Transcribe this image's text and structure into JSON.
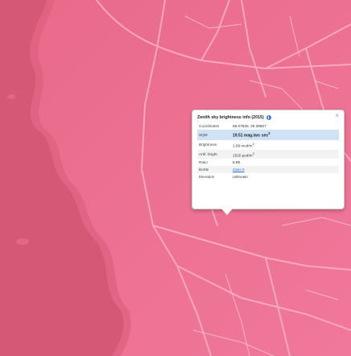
{
  "map": {
    "colors": {
      "water": "#d85a7a",
      "land": "#eb6f8f",
      "roads": "#f5a3ba"
    },
    "popup": {
      "title": "Zenith sky brightness info (2015)",
      "close_symbol": "×",
      "rows": [
        {
          "label": "Coordinates",
          "value": "65.07525, 25.39507",
          "sup": ""
        },
        {
          "label": "SQM",
          "value": "19.51 mag./arc sec",
          "sup": "2"
        },
        {
          "label": "Brightness",
          "value": "1.69 mcd/m",
          "sup": "2"
        },
        {
          "label": "Artif. bright.",
          "value": "1520 μcd/m",
          "sup": "2"
        },
        {
          "label": "Ratio",
          "value": "8.88",
          "sup": ""
        },
        {
          "label": "Bortle",
          "value": "class 5",
          "sup": ""
        },
        {
          "label": "Elevation",
          "value": "unknown",
          "sup": ""
        }
      ]
    }
  }
}
